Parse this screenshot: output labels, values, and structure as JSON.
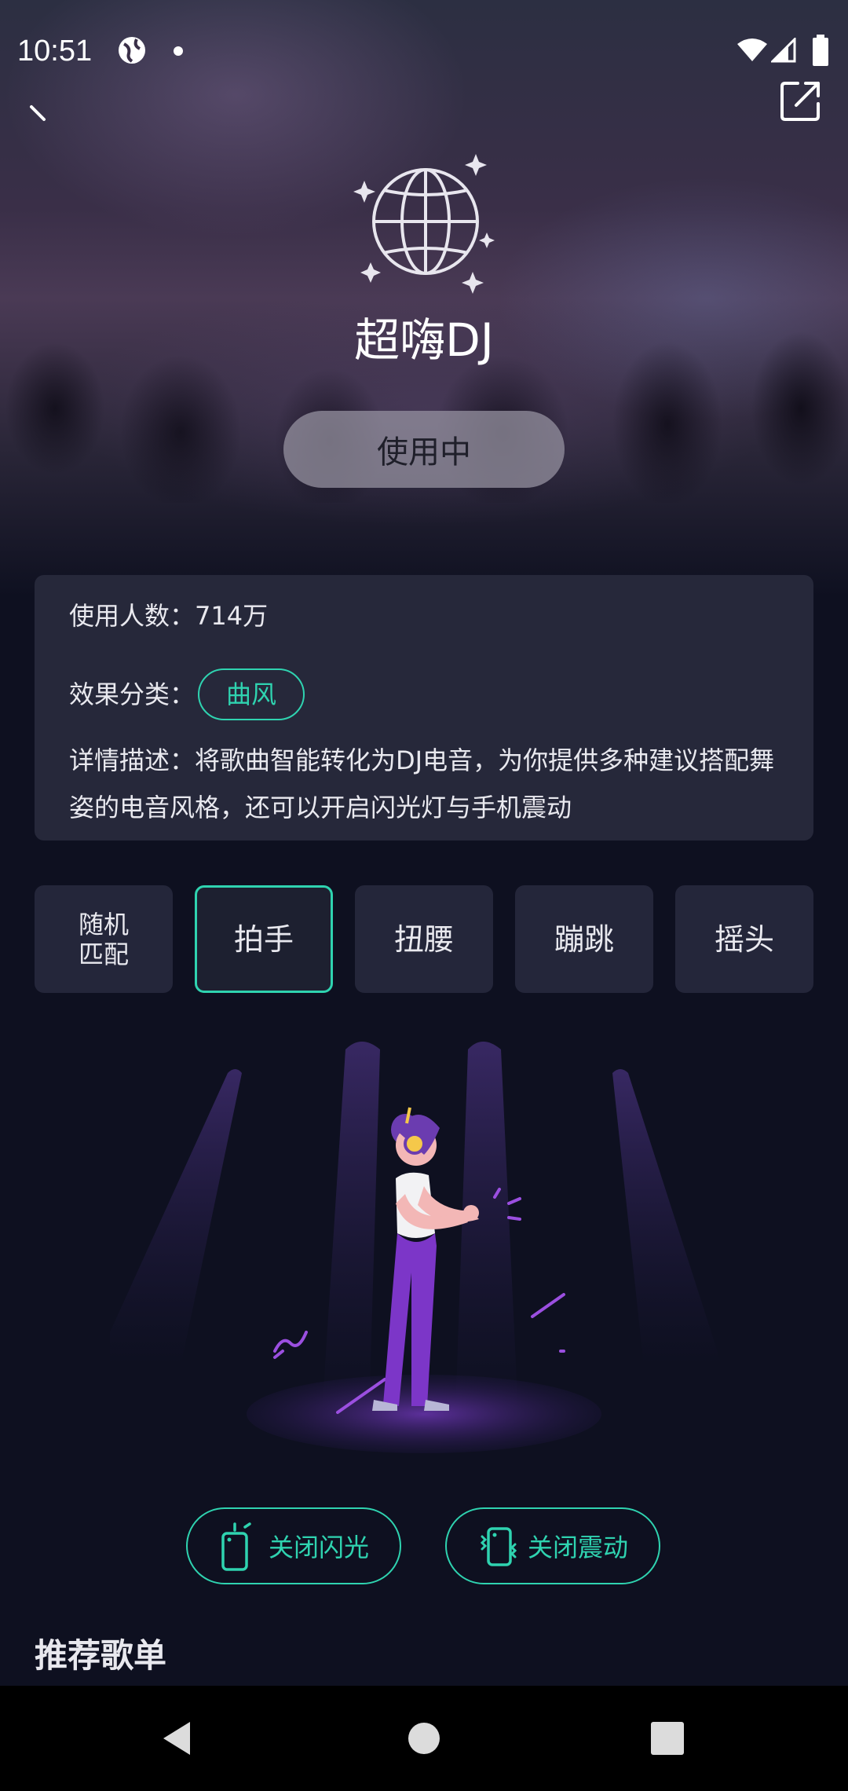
{
  "status": {
    "time": "10:51"
  },
  "header": {
    "title": "超嗨DJ",
    "use_button": "使用中"
  },
  "info": {
    "users_label": "使用人数：714万",
    "category_label": "效果分类：",
    "category_tag": "曲风",
    "description": "详情描述：将歌曲智能转化为DJ电音，为你提供多种建议搭配舞姿的电音风格，还可以开启闪光灯与手机震动"
  },
  "modes": [
    {
      "label": "随机\n匹配",
      "selected": false
    },
    {
      "label": "拍手",
      "selected": true
    },
    {
      "label": "扭腰",
      "selected": false
    },
    {
      "label": "蹦跳",
      "selected": false
    },
    {
      "label": "摇头",
      "selected": false
    }
  ],
  "controls": {
    "flash_label": "关闭闪光",
    "vibrate_label": "关闭震动"
  },
  "recommend": {
    "title": "推荐歌单"
  },
  "colors": {
    "accent": "#2fd3b0",
    "card_bg": "#26283a",
    "page_bg": "#0e1020"
  },
  "icons": [
    "back-icon",
    "share-icon",
    "disco-ball-icon",
    "flash-phone-icon",
    "vibrate-phone-icon",
    "nav-back-icon",
    "nav-home-icon",
    "nav-recents-icon"
  ]
}
